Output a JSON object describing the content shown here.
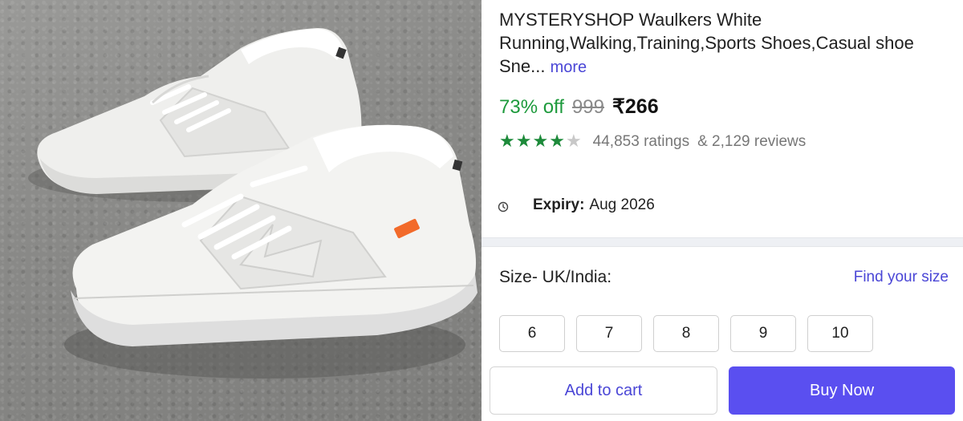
{
  "product": {
    "title": "MYSTERYSHOP Waulkers White Running,Walking,Training,Sports Shoes,Casual shoe Sne...",
    "more_label": "more",
    "image_alt": "white sneakers"
  },
  "pricing": {
    "discount": "73% off",
    "mrp": "999",
    "price": "₹266"
  },
  "rating": {
    "stars_filled": 4,
    "stars_total": 5,
    "ratings_count": "44,853 ratings",
    "reviews_count": "& 2,129 reviews",
    "star_color": "#1d8a3a"
  },
  "expiry": {
    "label": "Expiry:",
    "value": "Aug 2026",
    "icon": "clock-icon"
  },
  "size": {
    "label": "Size- UK/India:",
    "find_size": "Find your size",
    "options": [
      "6",
      "7",
      "8",
      "9",
      "10"
    ]
  },
  "actions": {
    "add_to_cart": "Add to cart",
    "buy_now": "Buy Now",
    "accent_color": "#5a4ff0"
  }
}
